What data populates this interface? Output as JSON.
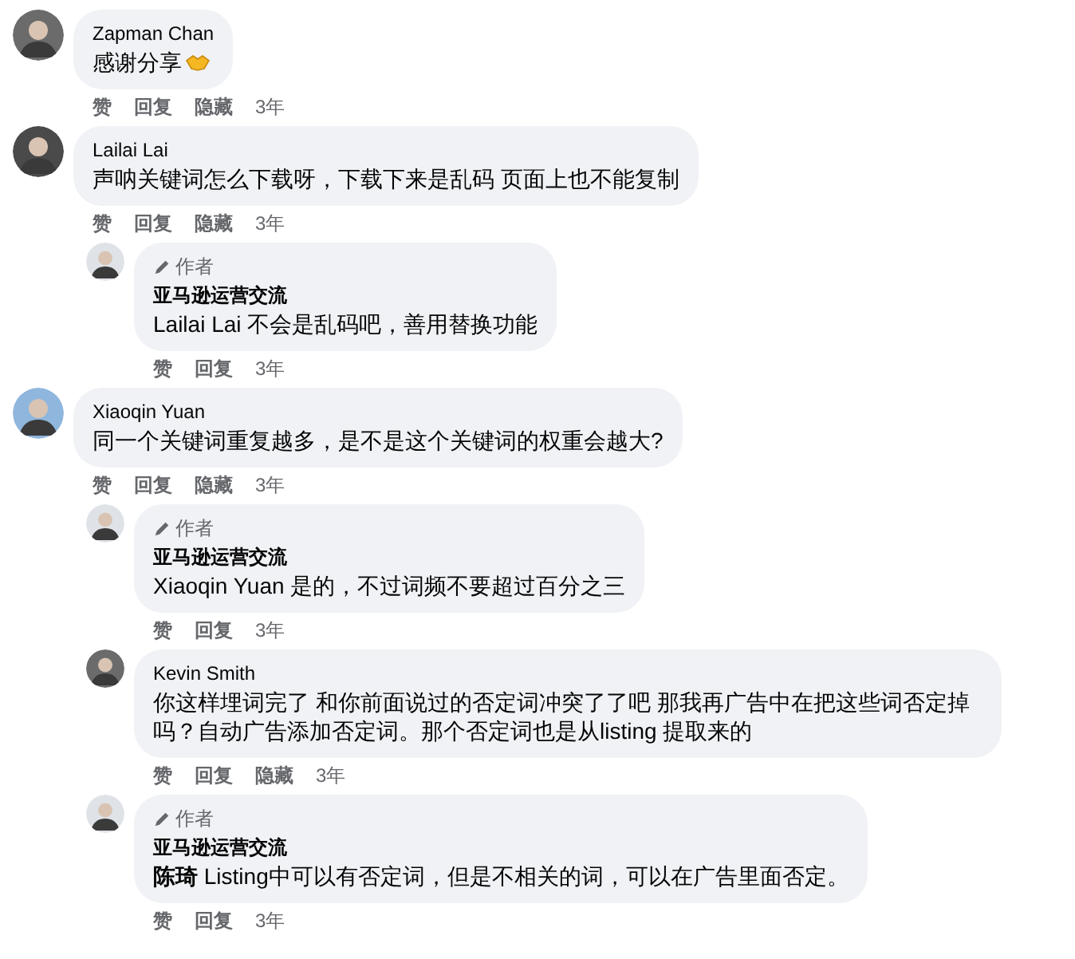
{
  "comments": [
    {
      "author": "Zapman Chan",
      "text": "感谢分享",
      "reaction_emoji": true,
      "actions": [
        "赞",
        "回复",
        "隐藏"
      ],
      "time": "3年"
    },
    {
      "author": "Lailai Lai",
      "text": "声呐关键词怎么下载呀，下载下来是乱码 页面上也不能复制",
      "actions": [
        "赞",
        "回复",
        "隐藏"
      ],
      "time": "3年",
      "children": [
        {
          "badge": "作者",
          "author": "亚马逊运营交流",
          "text": "Lailai Lai 不会是乱码吧，善用替换功能",
          "actions": [
            "赞",
            "回复"
          ],
          "time": "3年"
        }
      ]
    },
    {
      "author": "Xiaoqin Yuan",
      "text": "同一个关键词重复越多，是不是这个关键词的权重会越大?",
      "actions": [
        "赞",
        "回复",
        "隐藏"
      ],
      "time": "3年",
      "children": [
        {
          "badge": "作者",
          "author": "亚马逊运营交流",
          "text": "Xiaoqin Yuan 是的，不过词频不要超过百分之三",
          "actions": [
            "赞",
            "回复"
          ],
          "time": "3年"
        },
        {
          "author": "Kevin Smith",
          "text": "你这样埋词完了 和你前面说过的否定词冲突了了吧 那我再广告中在把这些词否定掉吗？自动广告添加否定词。那个否定词也是从listing 提取来的",
          "actions": [
            "赞",
            "回复",
            "隐藏"
          ],
          "time": "3年"
        },
        {
          "badge": "作者",
          "author": "亚马逊运营交流",
          "text": "**陈琦** Listing中可以有否定词，但是不相关的词，可以在广告里面否定。",
          "actions": [
            "赞",
            "回复"
          ],
          "time": "3年"
        }
      ]
    }
  ]
}
